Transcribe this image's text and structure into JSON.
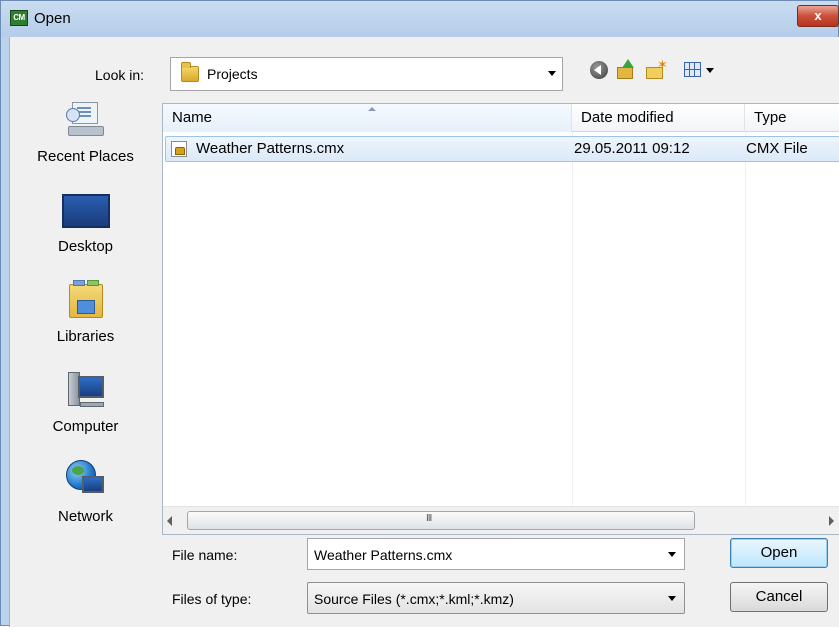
{
  "window": {
    "title": "Open",
    "app_icon_text": "CM",
    "close_glyph": "x"
  },
  "lookin": {
    "label": "Look in:",
    "value": "Projects"
  },
  "toolbar": {
    "icons": [
      "back-icon",
      "up-one-level-icon",
      "new-folder-icon",
      "views-menu-icon"
    ]
  },
  "places": [
    {
      "label": "Recent Places",
      "icon": "recent-places-icon"
    },
    {
      "label": "Desktop",
      "icon": "desktop-icon"
    },
    {
      "label": "Libraries",
      "icon": "libraries-icon"
    },
    {
      "label": "Computer",
      "icon": "computer-icon"
    },
    {
      "label": "Network",
      "icon": "network-icon"
    }
  ],
  "filelist": {
    "columns": [
      "Name",
      "Date modified",
      "Type"
    ],
    "rows": [
      {
        "name": "Weather Patterns.cmx",
        "date": "29.05.2011 09:12",
        "type": "CMX File",
        "selected": true
      }
    ],
    "scroll_grip": "III"
  },
  "form": {
    "file_name_label": "File name:",
    "file_name_value": "Weather Patterns.cmx",
    "files_of_type_label": "Files of type:",
    "files_of_type_value": "Source Files (*.cmx;*.kml;*.kmz)"
  },
  "buttons": {
    "open": "Open",
    "cancel": "Cancel"
  },
  "colors": {
    "selection": "#dbe9f8",
    "close_button": "#c9503b",
    "title_bar": "#bcd3ec"
  }
}
